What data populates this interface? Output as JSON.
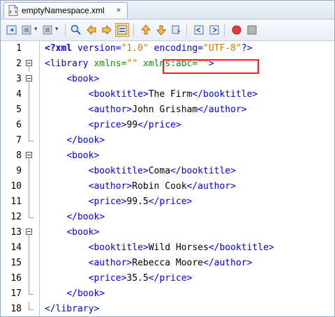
{
  "tab": {
    "title": "emptyNamespace.xml",
    "close": "×",
    "file_icon": "xml-file-icon"
  },
  "toolbar": {
    "buttons": [
      "back-icon",
      "history-icon",
      "forward-icon",
      "search-icon",
      "prev-occurrence-icon",
      "next-occurrence-icon",
      "toggle-highlight-icon",
      "prev-bookmark-icon",
      "next-bookmark-icon",
      "toggle-bookmark-icon",
      "shift-left-icon",
      "shift-right-icon",
      "macro-record-icon",
      "macro-stop-icon"
    ]
  },
  "editor": {
    "lines": [
      {
        "n": "1",
        "fold": "none",
        "tokens": [
          {
            "t": "pi-b",
            "v": "<?xml"
          },
          {
            "t": "pi",
            "v": " version="
          },
          {
            "t": "val",
            "v": "\"1.0\""
          },
          {
            "t": "pi",
            "v": " encoding="
          },
          {
            "t": "val",
            "v": "\"UTF-8\""
          },
          {
            "t": "pi",
            "v": "?>"
          }
        ]
      },
      {
        "n": "2",
        "fold": "open",
        "tokens": [
          {
            "t": "tag",
            "v": "<library "
          },
          {
            "t": "attr",
            "v": "xmlns="
          },
          {
            "t": "val",
            "v": "\"\""
          },
          {
            "t": "txt",
            "v": " "
          },
          {
            "t": "attr",
            "v": "xmlns:abc="
          },
          {
            "t": "val",
            "v": "\"\""
          },
          {
            "t": "tag",
            "v": ">"
          }
        ]
      },
      {
        "n": "3",
        "fold": "open",
        "tokens": [
          {
            "t": "txt",
            "v": "    "
          },
          {
            "t": "tag",
            "v": "<book>"
          }
        ]
      },
      {
        "n": "4",
        "fold": "mid",
        "tokens": [
          {
            "t": "txt",
            "v": "        "
          },
          {
            "t": "tag",
            "v": "<booktitle>"
          },
          {
            "t": "txt",
            "v": "The Firm"
          },
          {
            "t": "tag",
            "v": "</booktitle>"
          }
        ]
      },
      {
        "n": "5",
        "fold": "mid",
        "tokens": [
          {
            "t": "txt",
            "v": "        "
          },
          {
            "t": "tag",
            "v": "<author>"
          },
          {
            "t": "txt",
            "v": "John Grisham"
          },
          {
            "t": "tag",
            "v": "</author>"
          }
        ]
      },
      {
        "n": "6",
        "fold": "mid",
        "tokens": [
          {
            "t": "txt",
            "v": "        "
          },
          {
            "t": "tag",
            "v": "<price>"
          },
          {
            "t": "txt",
            "v": "99"
          },
          {
            "t": "tag",
            "v": "</price>"
          }
        ]
      },
      {
        "n": "7",
        "fold": "end",
        "tokens": [
          {
            "t": "txt",
            "v": "    "
          },
          {
            "t": "tag",
            "v": "</book>"
          }
        ]
      },
      {
        "n": "8",
        "fold": "open",
        "tokens": [
          {
            "t": "txt",
            "v": "    "
          },
          {
            "t": "tag",
            "v": "<book>"
          }
        ]
      },
      {
        "n": "9",
        "fold": "mid",
        "tokens": [
          {
            "t": "txt",
            "v": "        "
          },
          {
            "t": "tag",
            "v": "<booktitle>"
          },
          {
            "t": "txt",
            "v": "Coma"
          },
          {
            "t": "tag",
            "v": "</booktitle>"
          }
        ]
      },
      {
        "n": "10",
        "fold": "mid",
        "tokens": [
          {
            "t": "txt",
            "v": "        "
          },
          {
            "t": "tag",
            "v": "<author>"
          },
          {
            "t": "txt",
            "v": "Robin Cook"
          },
          {
            "t": "tag",
            "v": "</author>"
          }
        ]
      },
      {
        "n": "11",
        "fold": "mid",
        "tokens": [
          {
            "t": "txt",
            "v": "        "
          },
          {
            "t": "tag",
            "v": "<price>"
          },
          {
            "t": "txt",
            "v": "99.5"
          },
          {
            "t": "tag",
            "v": "</price>"
          }
        ]
      },
      {
        "n": "12",
        "fold": "end",
        "tokens": [
          {
            "t": "txt",
            "v": "    "
          },
          {
            "t": "tag",
            "v": "</book>"
          }
        ]
      },
      {
        "n": "13",
        "fold": "open",
        "tokens": [
          {
            "t": "txt",
            "v": "    "
          },
          {
            "t": "tag",
            "v": "<book>"
          }
        ]
      },
      {
        "n": "14",
        "fold": "mid",
        "tokens": [
          {
            "t": "txt",
            "v": "        "
          },
          {
            "t": "tag",
            "v": "<booktitle>"
          },
          {
            "t": "txt",
            "v": "Wild Horses"
          },
          {
            "t": "tag",
            "v": "</booktitle>"
          }
        ]
      },
      {
        "n": "15",
        "fold": "mid",
        "tokens": [
          {
            "t": "txt",
            "v": "        "
          },
          {
            "t": "tag",
            "v": "<author>"
          },
          {
            "t": "txt",
            "v": "Rebecca Moore"
          },
          {
            "t": "tag",
            "v": "</author>"
          }
        ]
      },
      {
        "n": "16",
        "fold": "mid",
        "tokens": [
          {
            "t": "txt",
            "v": "        "
          },
          {
            "t": "tag",
            "v": "<price>"
          },
          {
            "t": "txt",
            "v": "35.5"
          },
          {
            "t": "tag",
            "v": "</price>"
          }
        ]
      },
      {
        "n": "17",
        "fold": "end",
        "tokens": [
          {
            "t": "txt",
            "v": "    "
          },
          {
            "t": "tag",
            "v": "</book>"
          }
        ]
      },
      {
        "n": "18",
        "fold": "end",
        "tokens": [
          {
            "t": "tag",
            "v": "</library>"
          }
        ]
      }
    ]
  },
  "highlight": {
    "color": "#ff1a1a",
    "target": "xmlns:abc"
  },
  "colors": {
    "tag": "#0000e6",
    "attribute": "#009900",
    "value": "#ce7b00",
    "text": "#000000"
  }
}
